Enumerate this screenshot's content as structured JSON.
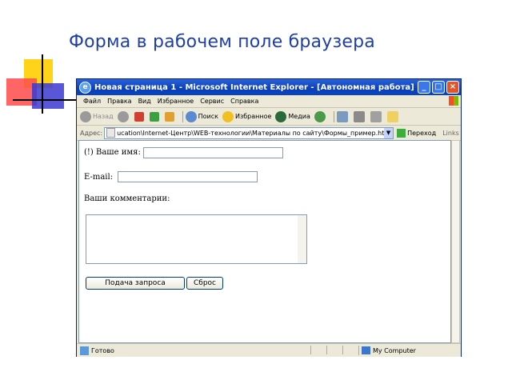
{
  "slide": {
    "title": "Форма в рабочем поле браузера"
  },
  "window": {
    "title": "Новая страница 1 - Microsoft Internet Explorer - [Автономная работа]",
    "minimize": "_",
    "maximize": "□",
    "close": "×"
  },
  "menu": [
    "Файл",
    "Правка",
    "Вид",
    "Избранное",
    "Сервис",
    "Справка"
  ],
  "toolbar": {
    "back": "Назад",
    "search": "Поиск",
    "favorites": "Избранное",
    "media": "Медиа"
  },
  "address": {
    "label": "Адрес:",
    "url": "ucation\\Internet-Центр\\WEB-технологии\\Материалы по сайту\\Формы_пример.htm",
    "go": "Переход",
    "links": "Links"
  },
  "form": {
    "name_label": "(!) Ваше имя:",
    "email_label": "E-mail:",
    "comments_label": "Ваши комментарии:",
    "submit": "Подача запроса",
    "reset": "Сброс"
  },
  "status": {
    "text": "Готово",
    "zone": "My Computer"
  },
  "colors": {
    "title": "#1f3fa8",
    "titlebar": "#0a3fb8"
  }
}
